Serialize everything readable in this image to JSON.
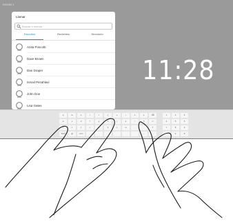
{
  "screen": {
    "room_label": "ROOM 1",
    "clock": "11:28"
  },
  "panel": {
    "title": "Llamar",
    "search_placeholder": "Buscar o marcar",
    "tabs": [
      {
        "label": "Favoritos",
        "active": true
      },
      {
        "label": "Recientes",
        "active": false
      },
      {
        "label": "Directorio",
        "active": false
      }
    ],
    "contacts": [
      {
        "name": "Anita Poscotti"
      },
      {
        "name": "Dave Brown"
      },
      {
        "name": "Dan Draper"
      },
      {
        "name": "Ismail Pezahlavi"
      },
      {
        "name": "John Doe"
      },
      {
        "name": "Lisa Gates"
      }
    ]
  },
  "keyboard": {
    "rows": [
      [
        "q",
        "w",
        "e",
        "r",
        "t",
        "y",
        "u",
        "i",
        "o",
        "p",
        "⌫"
      ],
      [
        "a",
        "s",
        "d",
        "f",
        "g",
        "h",
        "j",
        "k",
        "l",
        "ñ",
        "↵"
      ],
      [
        "⇧",
        "z",
        "x",
        "c",
        "v",
        "b",
        "n",
        "m",
        ",",
        ".",
        "⇧"
      ],
      [
        "?123",
        "@",
        ".com",
        "",
        "",
        "",
        "",
        "",
        "",
        "←",
        "→"
      ]
    ],
    "numpad": [
      [
        "1",
        "2",
        "3"
      ],
      [
        "4",
        "5",
        "6"
      ],
      [
        "7",
        "8",
        "9"
      ],
      [
        "*",
        "0",
        "#"
      ]
    ]
  },
  "colors": {
    "accent": "#00a0d1",
    "screen_bg": "#9a9a9a",
    "panel_bg": "#ffffff"
  }
}
